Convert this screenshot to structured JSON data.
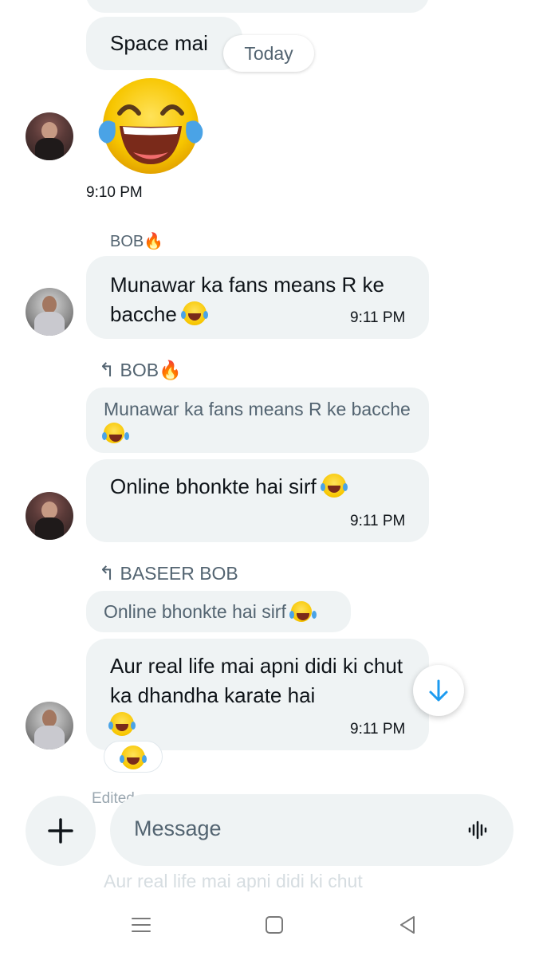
{
  "messages": {
    "m0": {
      "text": "Space mai"
    },
    "date_chip": "Today",
    "m1": {
      "time": "9:10 PM"
    },
    "m2": {
      "sender": "BOB🔥",
      "text": "Munawar ka fans means R ke bacche",
      "time": "9:11 PM"
    },
    "m3": {
      "reply_to": "BOB🔥",
      "quote": "Munawar ka fans means R ke bacche",
      "text": "Online bhonkte hai sirf",
      "time": "9:11 PM"
    },
    "m4": {
      "reply_to": "BASEER BOB",
      "quote": "Online bhonkte hai sirf",
      "text": "Aur real life mai apni didi ki chut ka dhandha karate hai",
      "time": "9:11 PM",
      "edited_label": "Edited"
    },
    "faded_preview": "Aur real life mai apni didi ki chut"
  },
  "composer": {
    "placeholder": "Message"
  },
  "icons": {
    "add": "plus-icon",
    "voice": "waveform-icon",
    "scroll_down": "arrow-down-icon",
    "reply": "reply-arrow-icon"
  },
  "colors": {
    "accent": "#1d9bf0",
    "bubble": "#eff3f4",
    "secondary_text": "#536471"
  }
}
